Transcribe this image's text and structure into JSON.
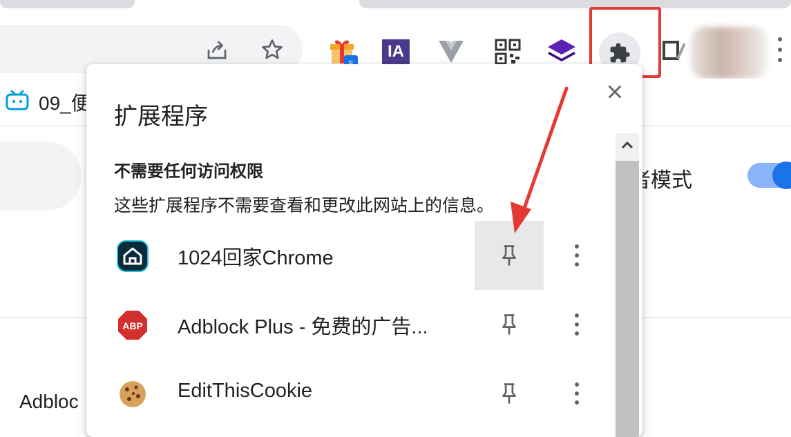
{
  "bookmarks": [
    {
      "label": "09_便",
      "icon": "bilibili-tv-icon"
    }
  ],
  "toolbar": {
    "icons": [
      "share-icon",
      "star-icon"
    ],
    "extension_icons": [
      "gift-extension-icon",
      "ia-extension-icon",
      "vue-extension-icon",
      "qr-code-extension-icon",
      "layers-extension-icon"
    ],
    "gift_badge": "s",
    "ia_label": "IA",
    "extensions_button": "puzzle-icon"
  },
  "page": {
    "right_text": "者模式",
    "bottom_text": "Adbloc"
  },
  "popup": {
    "title": "扩展程序",
    "close": "close-icon",
    "section_title": "不需要任何访问权限",
    "section_desc": "这些扩展程序不需要查看和更改此网站上的信息。",
    "extensions": [
      {
        "name": "1024回家Chrome",
        "icon": "home-icon",
        "pinned_hover": true
      },
      {
        "name": "Adblock Plus - 免费的广告...",
        "icon": "abp-icon",
        "abp_text": "ABP",
        "pinned_hover": false
      },
      {
        "name": "EditThisCookie",
        "icon": "cookie-icon",
        "pinned_hover": false
      }
    ]
  },
  "colors": {
    "accent": "#1a73e8",
    "highlight": "#e53935",
    "icon_gray": "#5f6368",
    "ia_purple": "#4b3a8c",
    "layers_purple": "#5b21b6",
    "abp_red": "#d32f2f"
  }
}
